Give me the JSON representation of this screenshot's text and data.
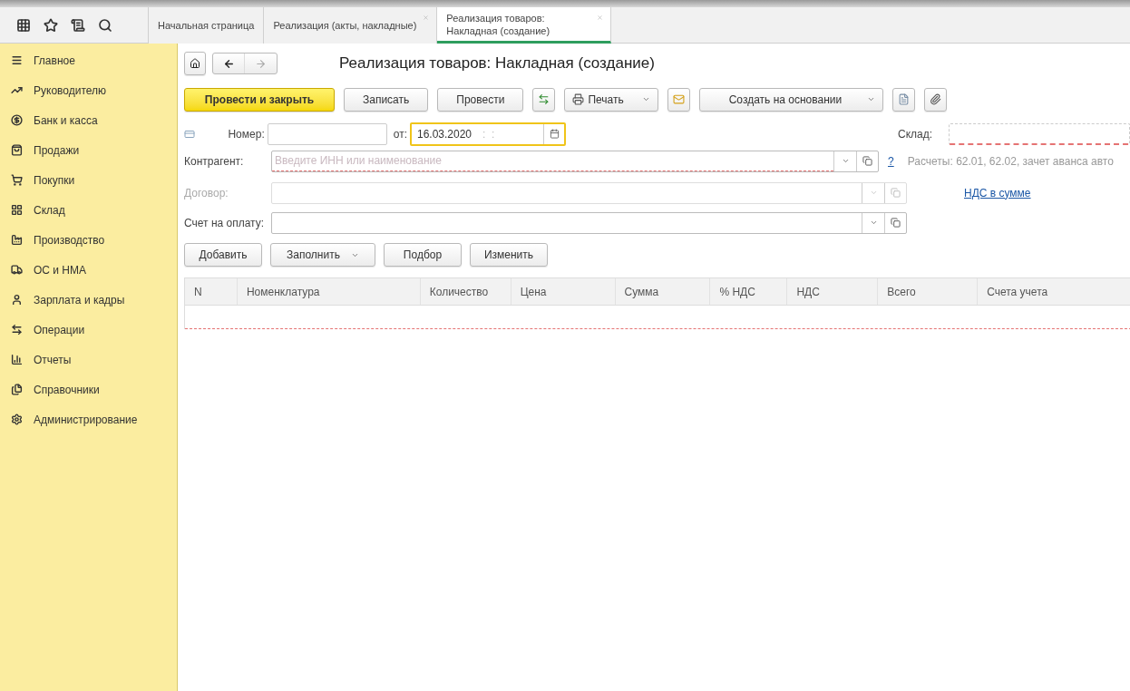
{
  "top_bar": {
    "tabs": [
      {
        "label": "Начальная страница",
        "selected": false,
        "closable": false
      },
      {
        "label": "Реализация (акты, накладные)",
        "selected": false,
        "closable": true
      },
      {
        "label": "Реализация товаров: Накладная (создание)",
        "selected": true,
        "closable": true
      }
    ]
  },
  "sidebar": {
    "items": [
      {
        "label": "Главное"
      },
      {
        "label": "Руководителю"
      },
      {
        "label": "Банк и касса"
      },
      {
        "label": "Продажи"
      },
      {
        "label": "Покупки"
      },
      {
        "label": "Склад"
      },
      {
        "label": "Производство"
      },
      {
        "label": "ОС и НМА"
      },
      {
        "label": "Зарплата и кадры"
      },
      {
        "label": "Операции"
      },
      {
        "label": "Отчеты"
      },
      {
        "label": "Справочники"
      },
      {
        "label": "Администрирование"
      }
    ]
  },
  "form": {
    "title": "Реализация товаров: Накладная (создание)",
    "toolbar": [
      {
        "kind": "default",
        "label": "Провести и закрыть"
      },
      {
        "kind": "button",
        "label": "Записать"
      },
      {
        "kind": "button",
        "label": "Провести"
      },
      {
        "kind": "icon"
      },
      {
        "kind": "dropdown",
        "label": "Печать"
      },
      {
        "kind": "icon"
      },
      {
        "kind": "dropdown",
        "label": "Создать на основании"
      },
      {
        "kind": "icon"
      },
      {
        "kind": "icon"
      }
    ],
    "number": {
      "label": "Номер:"
    },
    "date": {
      "label": "от:",
      "value": "16.03.2020",
      "time_mask": ":  :",
      "focused": true
    },
    "warehouse": {
      "label": "Склад:",
      "required": true
    },
    "counterparty": {
      "label": "Контрагент:",
      "placeholder": "Введите ИНН или наименование",
      "required": true,
      "help": "?"
    },
    "settlements_note": "Расчеты: 62.01, 62.02, зачет аванса авто",
    "contract": {
      "label": "Договор:",
      "disabled": true
    },
    "vat_link": "НДС в сумме",
    "invoice": {
      "label": "Счет на оплату:",
      "disabled": false
    },
    "table_toolbar": [
      {
        "kind": "button",
        "label": "Добавить"
      },
      {
        "kind": "dropdown",
        "label": "Заполнить"
      },
      {
        "kind": "button",
        "label": "Подбор"
      },
      {
        "kind": "button",
        "label": "Изменить"
      }
    ],
    "table": {
      "required": true,
      "columns": [
        "N",
        "Номенклатура",
        "Количество",
        "Цена",
        "Сумма",
        "% НДС",
        "НДС",
        "Всего",
        "Счета учета"
      ]
    }
  }
}
